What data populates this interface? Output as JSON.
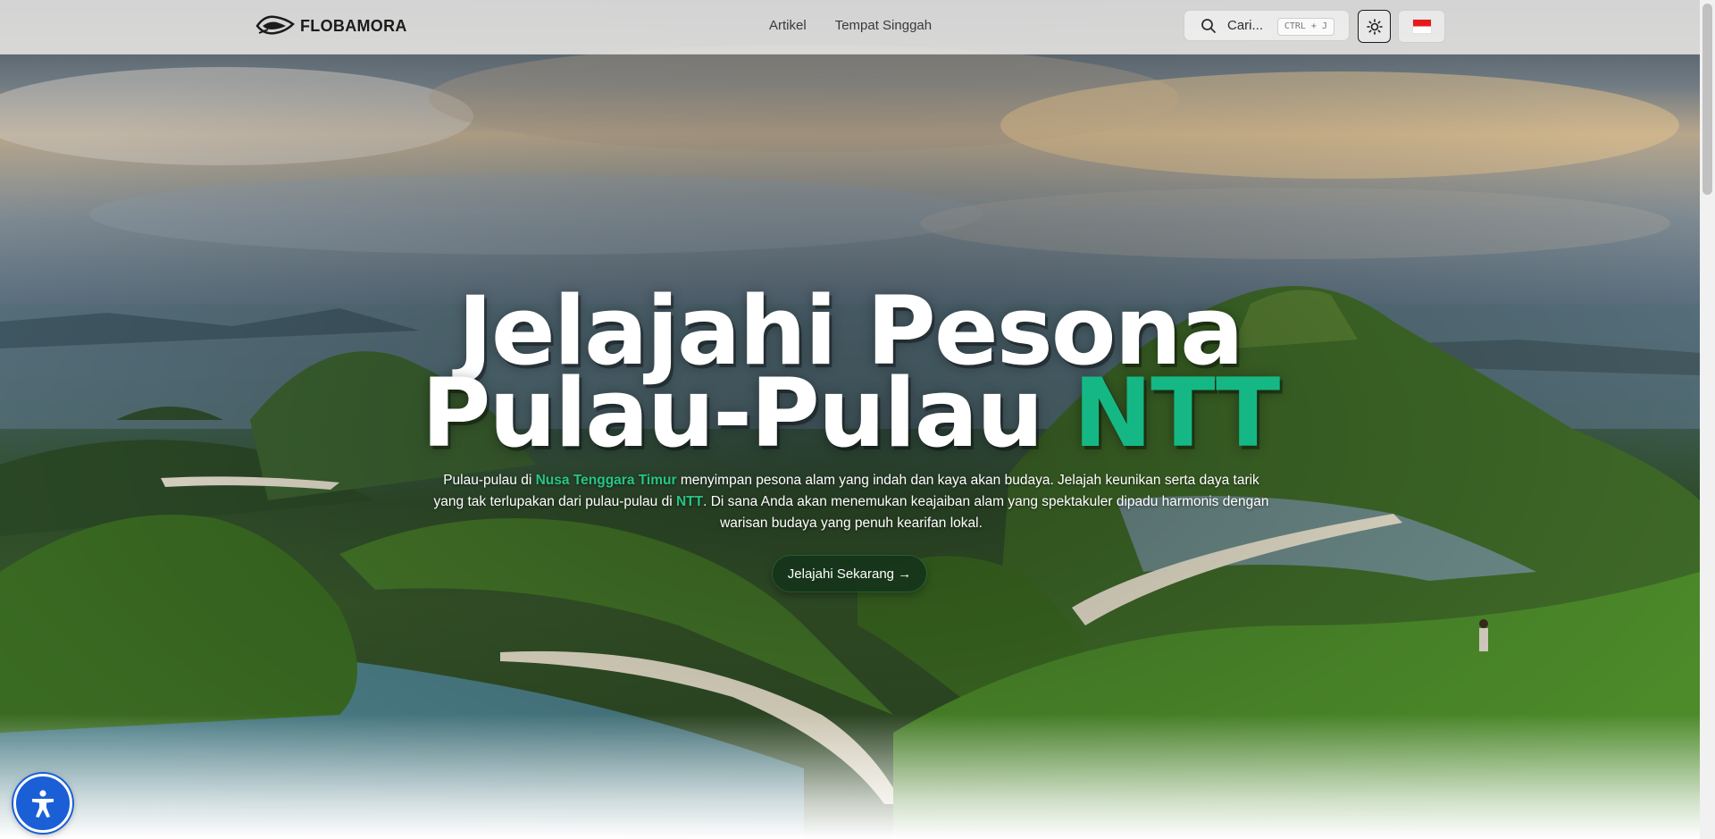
{
  "nav": {
    "logo_text": "FLOBAMORA",
    "links": [
      "Artikel",
      "Tempat Singgah"
    ],
    "search_placeholder": "Cari...",
    "search_shortcut": "CTRL + J",
    "theme_icon": "sun-icon",
    "language_flag": "indonesia-flag"
  },
  "hero": {
    "title_line1": "Jelajahi Pesona",
    "title_line2_a": "Pulau-Pulau",
    "title_line2_b": "NTT",
    "desc": {
      "p1": "Pulau-pulau di ",
      "hl1": "Nusa Tenggara Timur",
      "p2": " menyimpan pesona alam yang indah dan kaya akan budaya. Jelajah keunikan serta daya tarik yang tak terlupakan dari pulau-pulau di ",
      "hl2": "NTT",
      "p3": ". Di sana Anda akan menemukan keajaiban alam yang spektakuler dipadu harmonis dengan warisan budaya yang penuh kearifan lokal."
    },
    "cta_label": "Jelajahi Sekarang →"
  },
  "colors": {
    "accent_green": "#15b884",
    "cta_bg": "#16341a",
    "a11y_blue": "#1a5fd6"
  },
  "accessibility": {
    "icon": "accessibility-icon"
  }
}
